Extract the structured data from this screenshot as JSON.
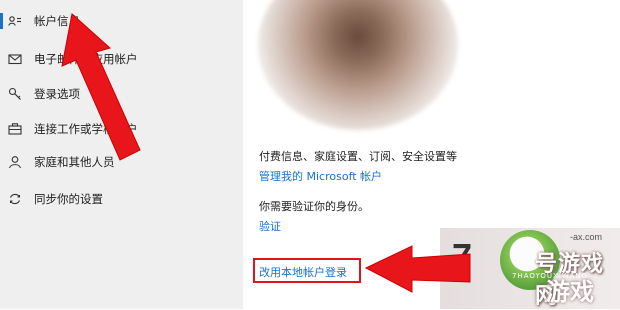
{
  "sidebar": {
    "items": [
      {
        "label": "帐户信息",
        "icon": "person-card-icon",
        "active": true
      },
      {
        "label": "电子邮件和应用帐户",
        "icon": "mail-icon",
        "active": false
      },
      {
        "label": "登录选项",
        "icon": "key-icon",
        "active": false
      },
      {
        "label": "连接工作或学校帐户",
        "icon": "briefcase-icon",
        "active": false
      },
      {
        "label": "家庭和其他人员",
        "icon": "person-icon",
        "active": false
      },
      {
        "label": "同步你的设置",
        "icon": "sync-icon",
        "active": false
      }
    ]
  },
  "main": {
    "settings_text": "付费信息、家庭设置、订阅、安全设置等",
    "manage_link": "管理我的 Microsoft 帐户",
    "verify_text": "你需要验证你的身份。",
    "verify_link": "验证",
    "local_login_link": "改用本地帐户登录"
  },
  "watermark": {
    "number": "7",
    "title": "号游戏网",
    "subtitle": "7HAOYOUXIWANG",
    "youxi": "游戏",
    "url": "-ax.com"
  },
  "colors": {
    "accent": "#1a6fd0",
    "highlight_box": "#e0141b",
    "arrow": "#e8161b",
    "sidebar_bg": "#efefef"
  }
}
